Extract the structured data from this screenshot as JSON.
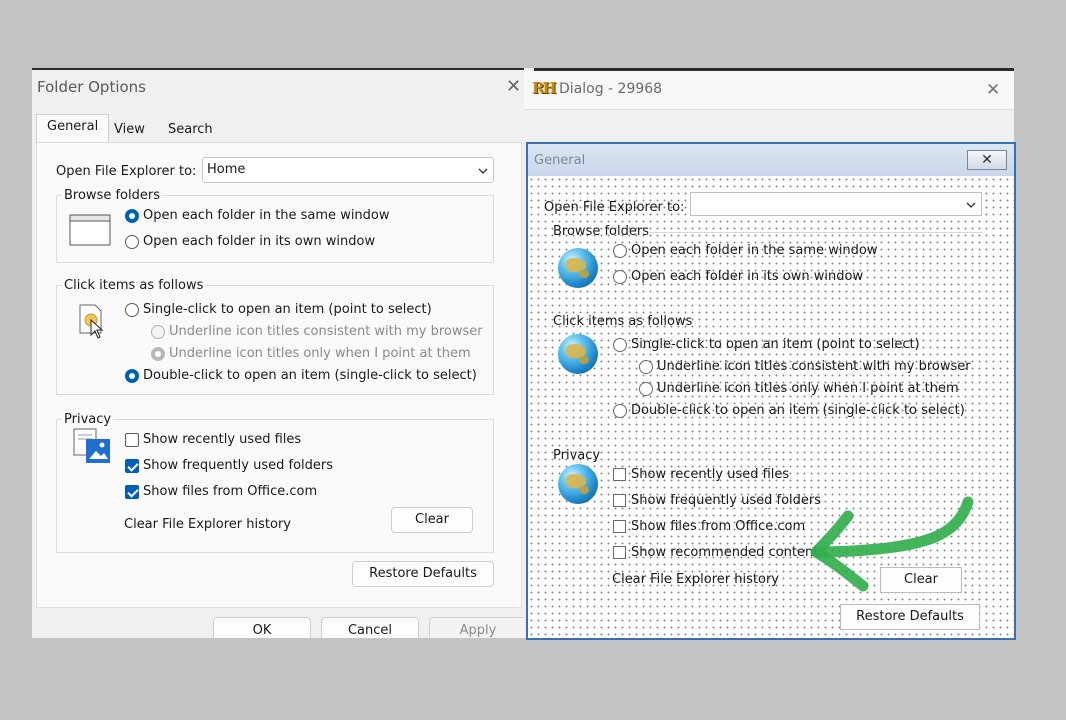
{
  "left_window": {
    "title": "Folder Options",
    "tabs": [
      "General",
      "View",
      "Search"
    ],
    "open_explorer_label": "Open File Explorer to:",
    "open_explorer_value": "Home",
    "browse_folders": {
      "label": "Browse folders",
      "option_same": "Open each folder in the same window",
      "option_own": "Open each folder in its own window"
    },
    "click_items": {
      "label": "Click items as follows",
      "single": "Single-click to open an item (point to select)",
      "underline_consistent": "Underline icon titles consistent with my browser",
      "underline_point": "Underline icon titles only when I point at them",
      "double": "Double-click to open an item (single-click to select)"
    },
    "privacy": {
      "label": "Privacy",
      "recent_files": "Show recently used files",
      "frequent_folders": "Show frequently used folders",
      "office_files": "Show files from Office.com",
      "clear_history_label": "Clear File Explorer history",
      "clear_button": "Clear"
    },
    "restore_defaults": "Restore Defaults",
    "ok": "OK",
    "cancel": "Cancel",
    "apply": "Apply"
  },
  "right_window": {
    "app_badge": "RH",
    "title": "Dialog - 29968",
    "inner_title": "General",
    "open_explorer_label": "Open File Explorer to:",
    "open_explorer_value": "",
    "browse_folders": {
      "label": "Browse folders",
      "option_same": "Open each folder in the same window",
      "option_own": "Open each folder in its own window"
    },
    "click_items": {
      "label": "Click items as follows",
      "single": "Single-click to open an item (point to select)",
      "underline_consistent": "Underline icon titles consistent with my browser",
      "underline_point": "Underline icon titles only when I point at them",
      "double": "Double-click to open an item (single-click to select)"
    },
    "privacy": {
      "label": "Privacy",
      "recent_files": "Show recently used files",
      "frequent_folders": "Show frequently used folders",
      "office_files": "Show files from Office.com",
      "recommended": "Show recommended content",
      "clear_history_label": "Clear File Explorer history",
      "clear_button": "Clear"
    },
    "restore_defaults": "Restore Defaults"
  },
  "colors": {
    "accent": "#005fb8",
    "annotation_arrow": "#2fae4a",
    "inner_frame": "#3a6fb4"
  },
  "icons": [
    "close-icon",
    "chevron-down-icon",
    "window-icon",
    "cursor-click-icon",
    "privacy-icon",
    "globe-icon",
    "rh-logo-icon",
    "annotation-arrow-icon"
  ]
}
